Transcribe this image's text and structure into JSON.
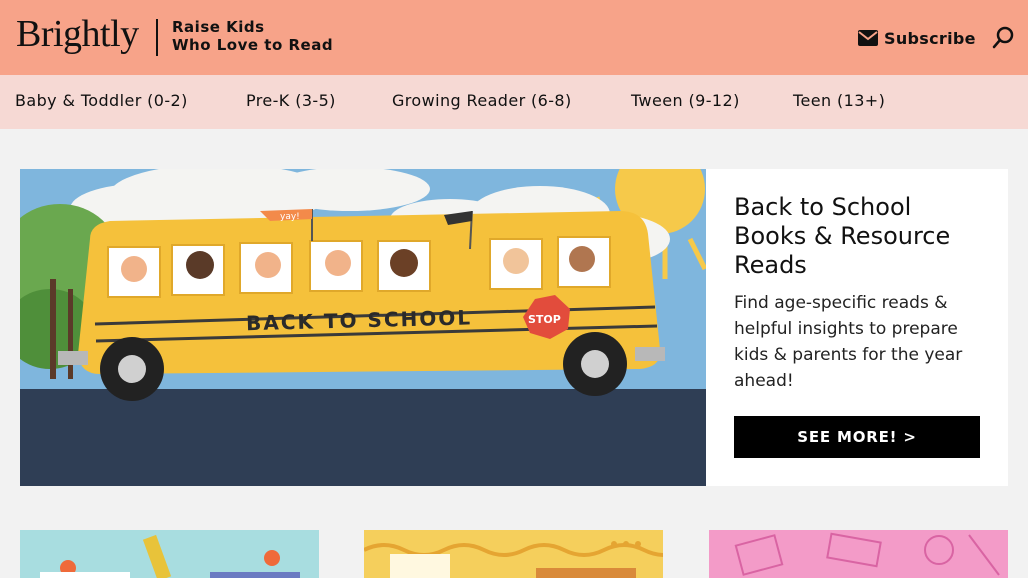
{
  "header": {
    "logo": "Brightly",
    "tagline_line1": "Raise Kids",
    "tagline_line2": "Who Love to Read",
    "subscribe_label": "Subscribe",
    "icons": {
      "subscribe": "envelope-icon",
      "search": "search-icon"
    }
  },
  "nav": {
    "items": [
      {
        "label": "Baby & Toddler (0-2)"
      },
      {
        "label": "Pre-K (3-5)"
      },
      {
        "label": "Growing Reader (6-8)"
      },
      {
        "label": "Tween (9-12)"
      },
      {
        "label": "Teen (13+)"
      }
    ]
  },
  "hero": {
    "image": {
      "flag_text": "yay!",
      "bus_text": "BACK TO SCHOOL",
      "sign_text": "STOP"
    },
    "title_line1": "Back to School",
    "title_line2": "Books & Resource",
    "title_line3": "Reads",
    "description": "Find age-specific reads & helpful insights to prepare kids & parents for the year ahead!",
    "cta_label": "SEE MORE! >"
  },
  "colors": {
    "header_bg": "#f7a389",
    "nav_bg": "#f6d9d4",
    "page_bg": "#f2f2f2",
    "cta_bg": "#000000"
  }
}
